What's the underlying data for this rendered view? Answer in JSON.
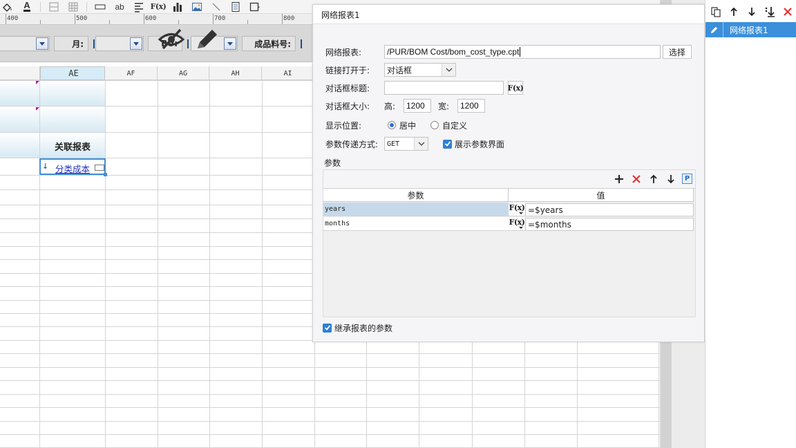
{
  "toolbar": {
    "font_color_label": "A",
    "text_label": "ab",
    "formula_label": "F(x)"
  },
  "ruler": [
    "400",
    "500",
    "600",
    "700",
    "800"
  ],
  "param_bar": {
    "month_label": "月:",
    "bu_label": "BU:",
    "product_label": "成品料号:"
  },
  "columns": [
    "AE",
    "AF",
    "AG",
    "AH",
    "AI"
  ],
  "cells": {
    "linked_report": "关联报表",
    "category_cost_link": "分类成本"
  },
  "dialog": {
    "title": "网络报表1",
    "report_label": "网络报表:",
    "report_path": "/PUR/BOM Cost/bom_cost_type.cpt",
    "choose_button": "选择",
    "open_in_label": "链接打开于:",
    "open_in_value": "对话框",
    "dialog_title_label": "对话框标题:",
    "dialog_title_value": "",
    "fx_label": "F(x)",
    "dialog_size_label": "对话框大小:",
    "height_label": "高:",
    "height_value": "1200",
    "width_label": "宽:",
    "width_value": "1200",
    "position_label": "显示位置:",
    "position_center": "居中",
    "position_custom": "自定义",
    "param_method_label": "参数传递方式:",
    "param_method_value": "GET",
    "show_param_ui_label": "展示参数界面",
    "params_group_label": "参数",
    "table_headers": {
      "param": "参数",
      "value": "值"
    },
    "params": [
      {
        "name": "years",
        "fx": "F(x)",
        "value": "=$years"
      },
      {
        "name": "months",
        "fx": "F(x)",
        "value": "=$months"
      }
    ],
    "inherit_params_label": "继承报表的参数",
    "p_button_label": "P"
  },
  "side_panel": {
    "item_label": "网络报表1"
  },
  "colors": {
    "accent": "#3b8fdb",
    "delete": "#e23333",
    "link": "#2233bb"
  }
}
